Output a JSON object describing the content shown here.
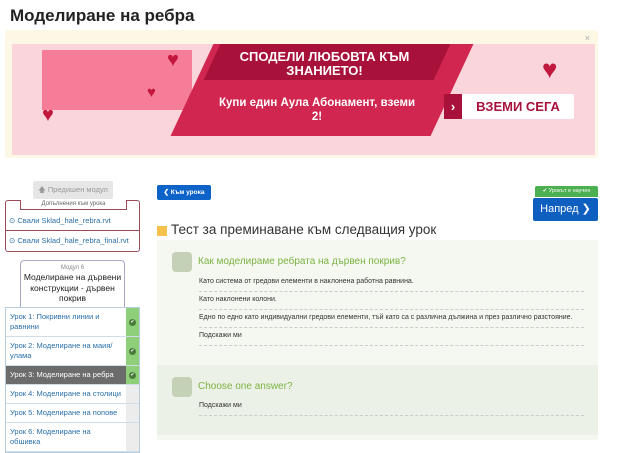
{
  "page": {
    "title": "Моделиране на ребра"
  },
  "promo": {
    "close": "×",
    "headline": "СПОДЕЛИ ЛЮБОВТА КЪМ ЗНАНИЕТО!",
    "offer": "Купи един Аула Абонамент, вземи 2!",
    "cta": "ВЗЕМИ СЕГА",
    "colors": {
      "primary": "#d0264f",
      "dark": "#a8123a",
      "background": "#fbd5dc"
    }
  },
  "sidebar": {
    "prev_module": "🡅 Предишен модул",
    "supplements_label": "Допълнения към урока",
    "downloads": [
      "Свали Sklad_hale_rebra.rvt",
      "Свали Sklad_hale_rebra_final.rvt"
    ],
    "module_number": "Модул 6",
    "module_title": "Моделиране на дървени конструкции - дървен покрив",
    "lessons": [
      {
        "label": "Урок 1: Покривни линии и равнини",
        "done": true
      },
      {
        "label": "Урок 2: Моделиране на маия/ улама",
        "done": true
      },
      {
        "label": "Урок 3: Моделиране на ребра",
        "done": true,
        "active": true
      },
      {
        "label": "Урок 4: Моделиране на столици",
        "done": false
      },
      {
        "label": "Урок 5: Моделиране на попове",
        "done": false
      },
      {
        "label": "Урок 6: Моделиране на обшивка",
        "done": false
      }
    ]
  },
  "main": {
    "back": "❮ Към урока",
    "learned": "✔ Урокът е научен",
    "next": "Напред ❯",
    "heading": "Тест за преминаване към следващия урок",
    "questions": [
      {
        "text": "Как моделираме ребрата на дървен покрив?",
        "answers": [
          "Като система от гредови елементи в наклонена работна равнина.",
          "Като наклонени колони.",
          "Едно по едно като индивидуални гредови елементи, тъй като са с различна дължина и през различно разстояние."
        ],
        "hint": "Подскажи ми"
      },
      {
        "text": "Choose one answer?",
        "answers": [],
        "hint": "Подскажи ми"
      }
    ]
  }
}
